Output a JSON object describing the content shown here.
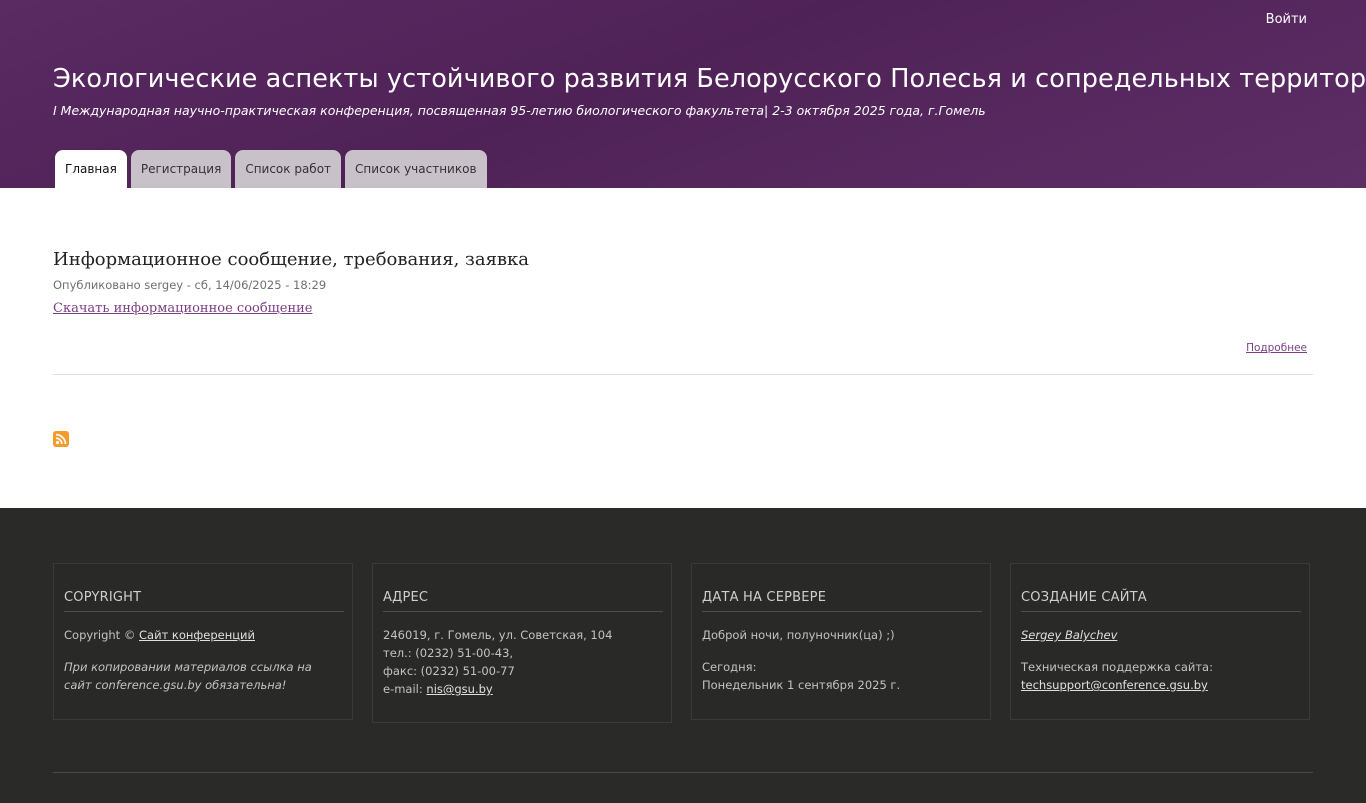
{
  "header": {
    "login": "Войти",
    "site_title": "Экологические аспекты устойчивого развития Белорусского Полесья и сопредельных территорий",
    "slogan": "I Международная научно-практическая конференция, посвященная 95-летию биологического факультета| 2-3 октября 2025 года, г.Гомель",
    "tabs": [
      "Главная",
      "Регистрация",
      "Список работ",
      "Список участников"
    ],
    "active_tab": "Главная"
  },
  "main": {
    "node_title": "Информационное сообщение, требования, заявка",
    "submitted": "Опубликовано sergey - сб, 14/06/2025 - 18:29",
    "download_link": "Скачать информационное сообщение",
    "read_more": "Подробнее",
    "rss_icon": "rss-feed-icon"
  },
  "footer": {
    "copyright": {
      "title": "COPYRIGHT",
      "prefix": "Copyright © ",
      "link": "Сайт конференций",
      "note": "При копировании материалов ссылка на сайт conference.gsu.by обязательна!"
    },
    "address": {
      "title": "АДРЕС",
      "line1": "246019, г. Гомель, ул. Советская, 104",
      "line2": "тел.: (0232) 51-00-43,",
      "line3": "факс: (0232) 51-00-77",
      "email_label": "e-mail: ",
      "email": "nis@gsu.by"
    },
    "server_date": {
      "title": "ДАТА НА СЕРВЕРЕ",
      "greeting": "Доброй ночи, полуночник(ца) ;)",
      "today_label": "Сегодня:",
      "today_value": "Понедельник 1 сентября 2025 г."
    },
    "site_creation": {
      "title": "СОЗДАНИЕ САЙТА",
      "author": "Sergey Balychev",
      "support_label": "Техническая поддержка сайта:",
      "support_email": "techsupport@conference.gsu.by"
    }
  },
  "colors": {
    "header_bg": "#552660",
    "link": "#7a3f83",
    "footer_bg": "#2a2a28",
    "rss": "#f39b2b"
  }
}
